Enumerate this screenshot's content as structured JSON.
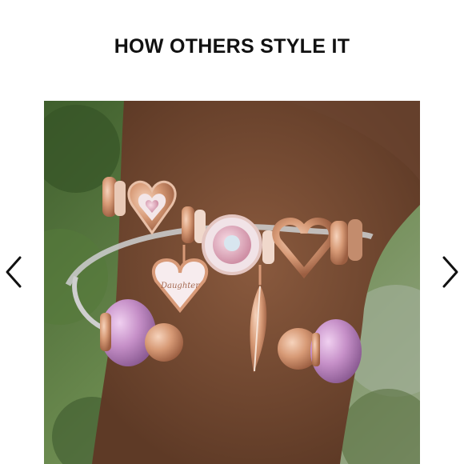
{
  "section": {
    "title": "HOW OTHERS STYLE IT"
  },
  "carousel": {
    "prev_icon": "chevron-left-icon",
    "next_icon": "chevron-right-icon",
    "image": {
      "description_icon": "bracelet-photo",
      "charm_text": "Daughter"
    }
  },
  "colors": {
    "title": "#111111",
    "arrow": "#111111",
    "rose_gold": "#d89a78",
    "skin": "#7a4e36",
    "foliage": "#4f6e3a",
    "purple_glass": "#c98fc8"
  }
}
